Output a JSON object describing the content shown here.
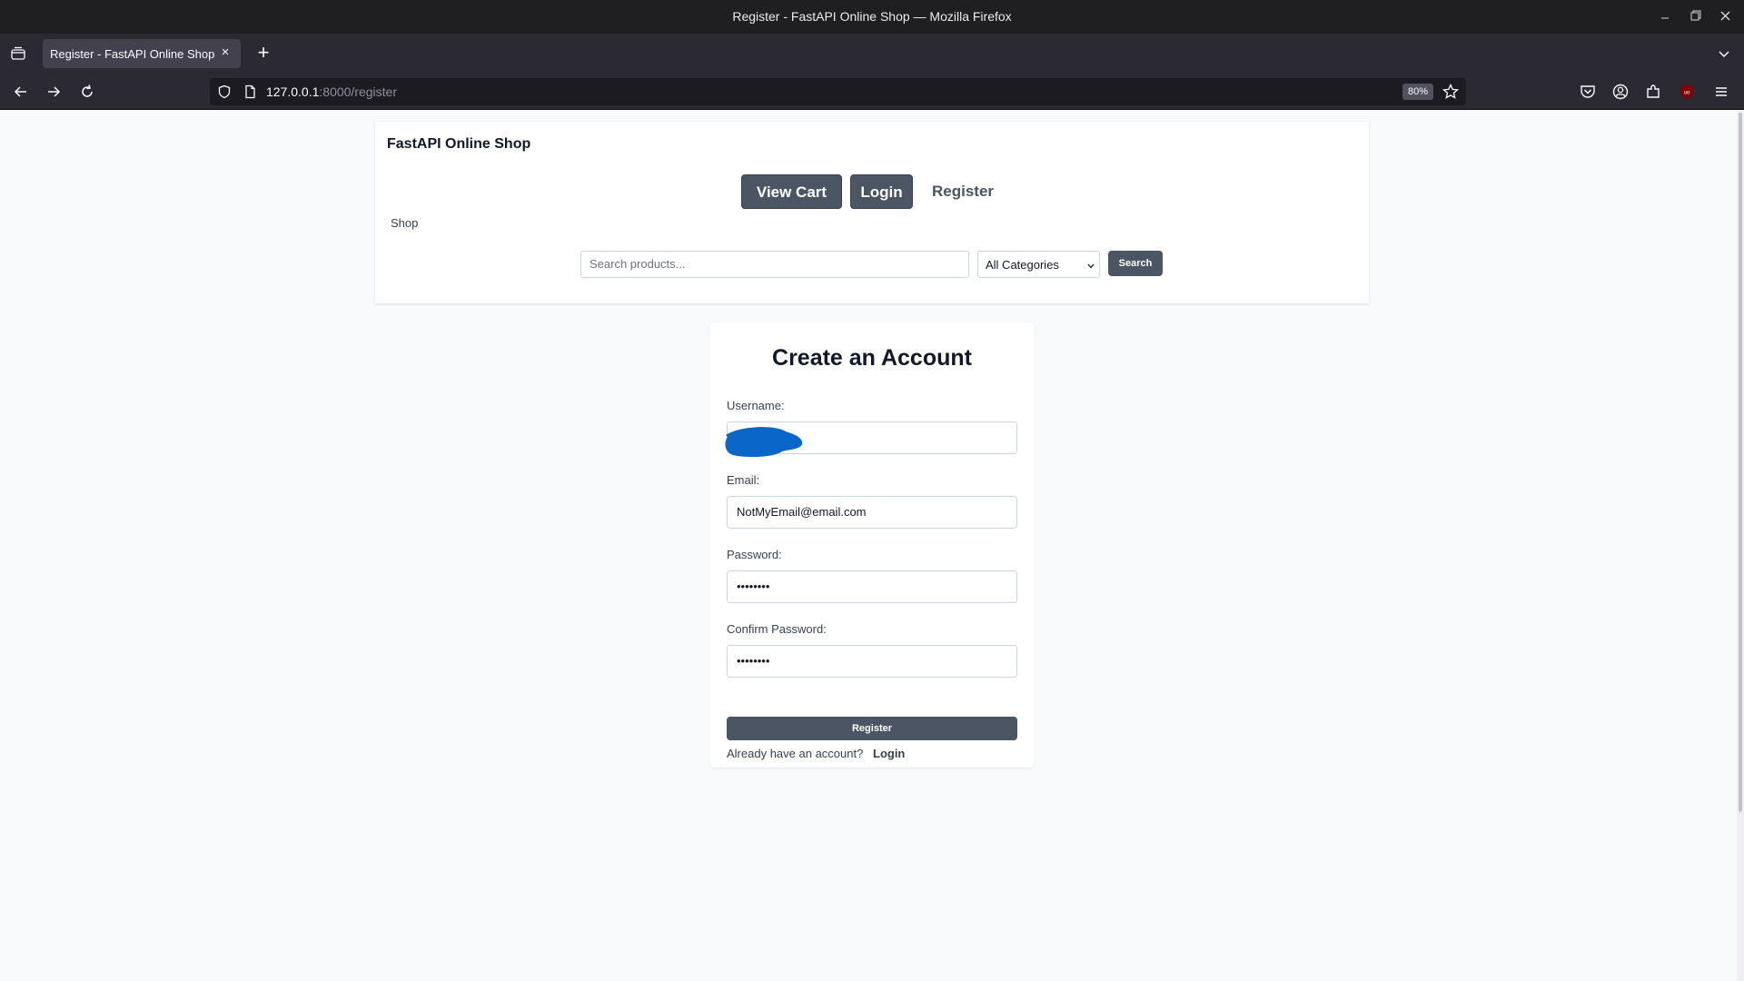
{
  "window": {
    "title": "Register - FastAPI Online Shop — Mozilla Firefox"
  },
  "tabs": [
    {
      "label": "Register - FastAPI Online Shop"
    }
  ],
  "urlbar": {
    "host": "127.0.0.1",
    "path": ":8000/register",
    "zoom": "80%"
  },
  "header": {
    "brand": "FastAPI Online Shop",
    "view_cart": "View Cart",
    "login": "Login",
    "register": "Register",
    "shop": "Shop",
    "search_placeholder": "Search products...",
    "category_selected": "All Categories",
    "search_button": "Search"
  },
  "form": {
    "title": "Create an Account",
    "username_label": "Username:",
    "username_value": "",
    "email_label": "Email:",
    "email_value": "NotMyEmail@email.com",
    "password_label": "Password:",
    "password_value": "••••••••",
    "confirm_label": "Confirm Password:",
    "confirm_value": "••••••••",
    "submit": "Register",
    "already_text": "Already have an account?",
    "login_link": "Login"
  },
  "colors": {
    "accent": "#4b5563",
    "redaction": "#0a66c8"
  }
}
